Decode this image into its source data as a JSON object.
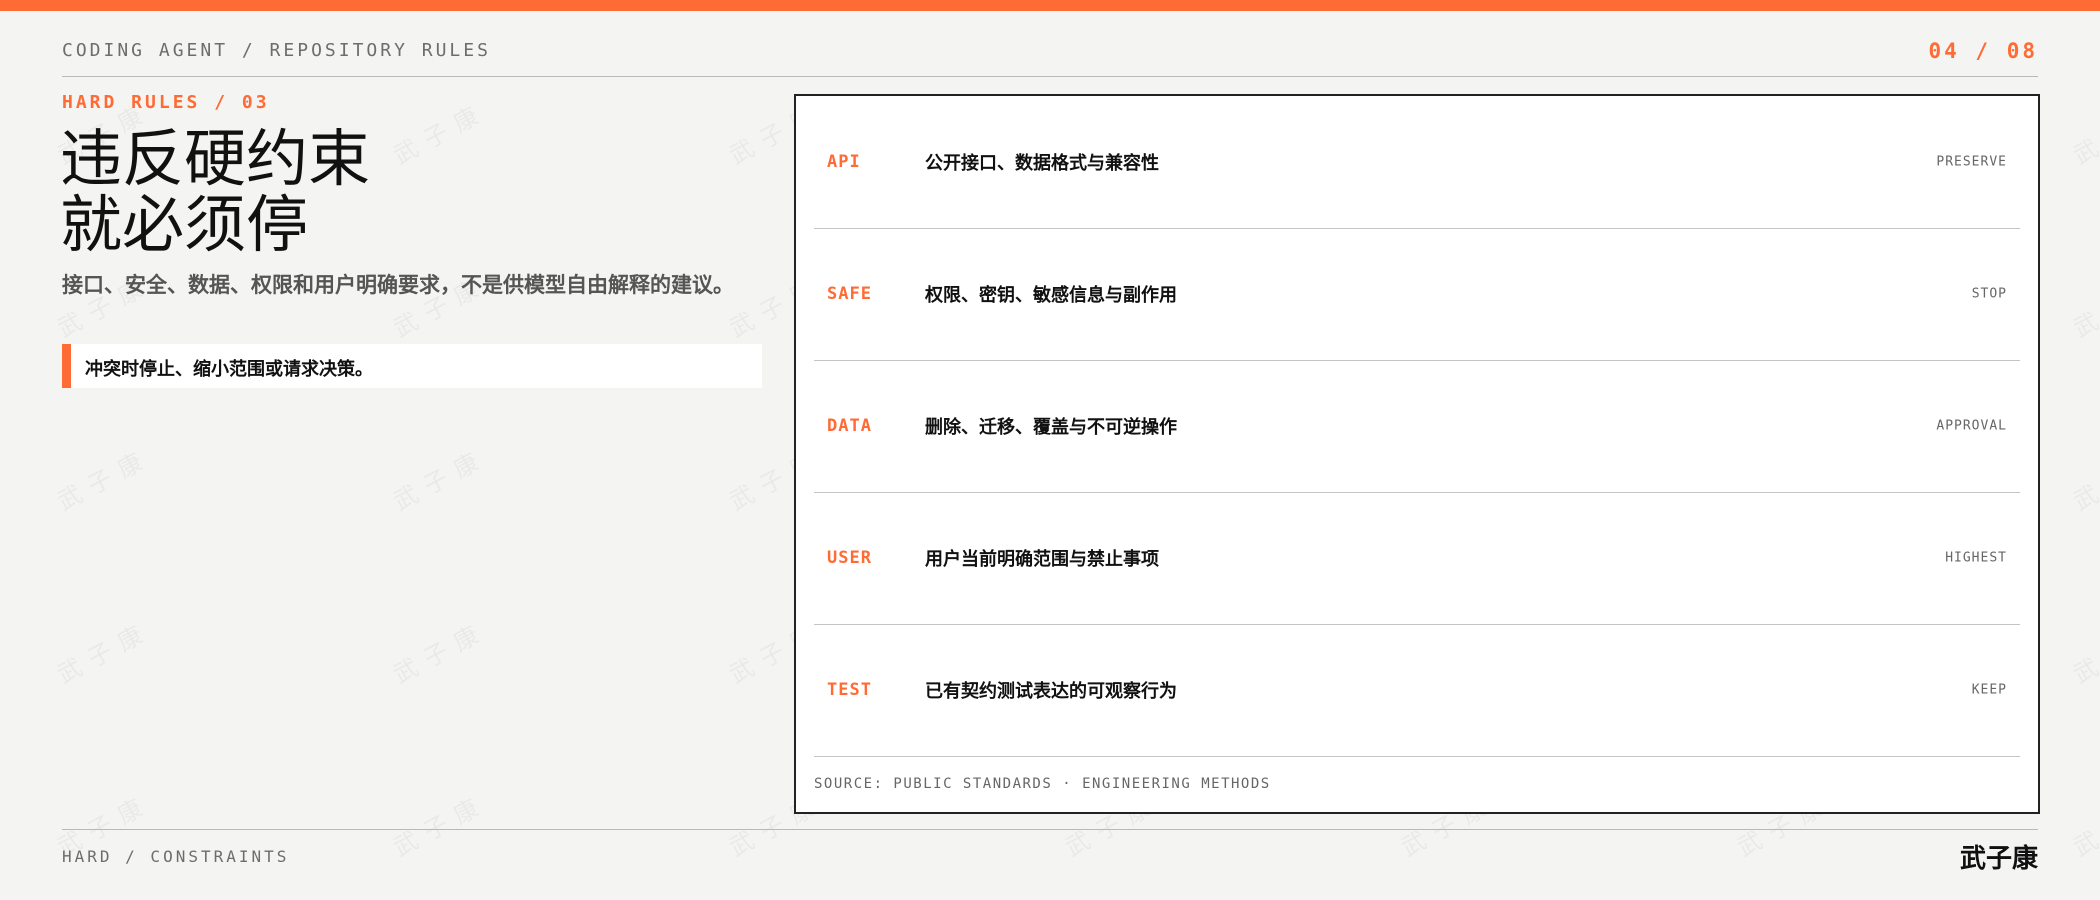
{
  "header": {
    "breadcrumb": "CODING AGENT / REPOSITORY RULES",
    "page_indicator": "04 / 08"
  },
  "left": {
    "eyebrow": "HARD RULES / 03",
    "title_line1": "违反硬约束",
    "title_line2": "就必须停",
    "subtitle": "接口、安全、数据、权限和用户明确要求，不是供模型自由解释的建议。",
    "callout": "冲突时停止、缩小范围或请求决策。"
  },
  "rules": [
    {
      "code": "API",
      "desc": "公开接口、数据格式与兼容性",
      "tag": "PRESERVE"
    },
    {
      "code": "SAFE",
      "desc": "权限、密钥、敏感信息与副作用",
      "tag": "STOP"
    },
    {
      "code": "DATA",
      "desc": "删除、迁移、覆盖与不可逆操作",
      "tag": "APPROVAL"
    },
    {
      "code": "USER",
      "desc": "用户当前明确范围与禁止事项",
      "tag": "HIGHEST"
    },
    {
      "code": "TEST",
      "desc": "已有契约测试表达的可观察行为",
      "tag": "KEEP"
    }
  ],
  "source": "SOURCE: PUBLIC STANDARDS · ENGINEERING METHODS",
  "footer": {
    "left": "HARD / CONSTRAINTS",
    "brand": "武子康"
  },
  "watermark": "武子康",
  "colors": {
    "accent": "#ff6b35",
    "background": "#f4f4f2",
    "panel": "#ffffff",
    "text": "#111111",
    "muted": "#6d6d6d"
  }
}
